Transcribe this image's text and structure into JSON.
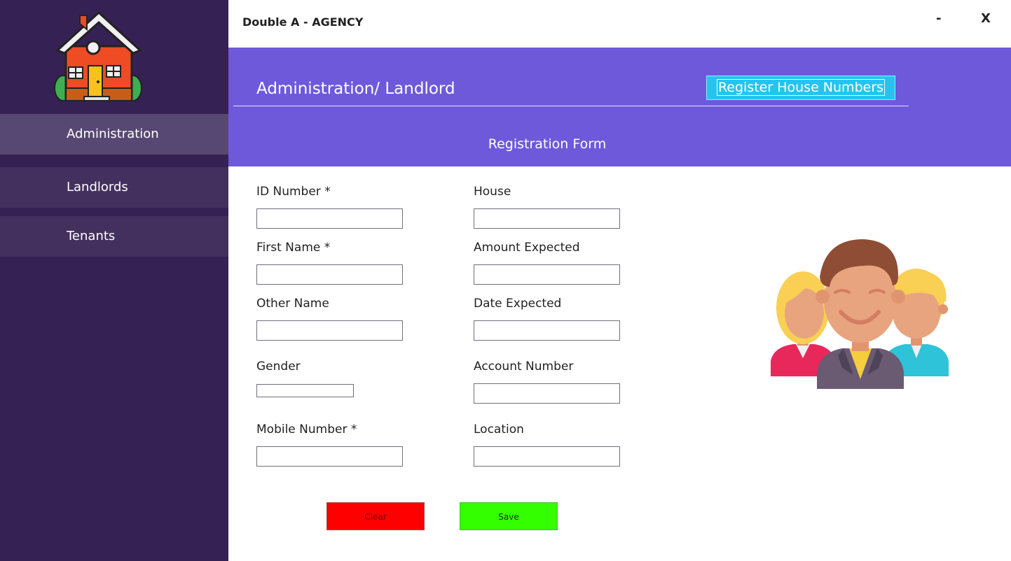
{
  "window": {
    "title": "Double A - AGENCY",
    "minimize_label": "-",
    "close_label": "X"
  },
  "sidebar": {
    "items": [
      {
        "label": "Administration",
        "active": true
      },
      {
        "label": "Landlords",
        "active": false
      },
      {
        "label": "Tenants",
        "active": false
      }
    ]
  },
  "header": {
    "title": "Administration/ Landlord",
    "register_button": "Register House Numbers",
    "form_title": "Registration Form"
  },
  "form": {
    "left": [
      {
        "label": "ID Number *",
        "value": ""
      },
      {
        "label": "First Name *",
        "value": ""
      },
      {
        "label": "Other Name",
        "value": ""
      },
      {
        "label": "Gender",
        "value": ""
      },
      {
        "label": "Mobile Number *",
        "value": ""
      }
    ],
    "right": [
      {
        "label": "House",
        "value": ""
      },
      {
        "label": "Amount Expected",
        "value": ""
      },
      {
        "label": "Date Expected",
        "value": ""
      },
      {
        "label": "Account Number",
        "value": ""
      },
      {
        "label": "Location",
        "value": ""
      }
    ],
    "clear_label": "Clear",
    "save_label": "Save"
  },
  "icons": {
    "logo": "house-icon",
    "illustration": "users-group-icon"
  },
  "colors": {
    "sidebar": "#362154",
    "sidebar_item": "#44305f",
    "sidebar_active": "#574873",
    "banner": "#6e59db",
    "register_button": "#27c3f0",
    "clear_button": "#ff0000",
    "save_button": "#33ff00"
  }
}
